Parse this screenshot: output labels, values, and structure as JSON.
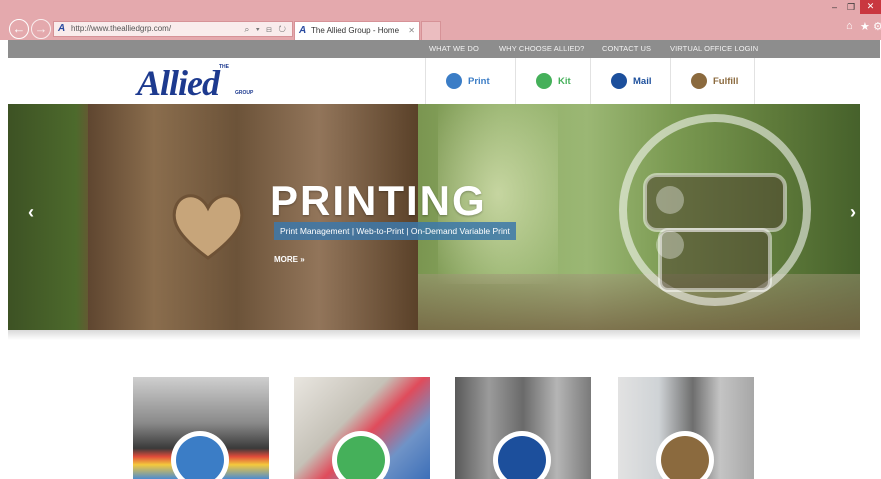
{
  "browser": {
    "back_glyph": "←",
    "forward_glyph": "→",
    "url": "http://www.thealliedgrp.com/",
    "address_tools": "⌕ ▾ ⊟ ↻",
    "tab_title": "The Allied Group - Home",
    "tab_close": "✕",
    "minimize": "–",
    "restore": "❐",
    "close": "✕",
    "home_glyph": "⌂",
    "star_glyph": "★",
    "gear_glyph": "⚙"
  },
  "site_nav": {
    "items": [
      "WHAT WE DO",
      "WHY CHOOSE ALLIED?",
      "CONTACT US",
      "VIRTUAL OFFICE LOGIN"
    ]
  },
  "logo": {
    "word": "Allied",
    "the": "THE",
    "group": "GROUP"
  },
  "services": [
    {
      "label": "Print",
      "color": "#3b7dc6"
    },
    {
      "label": "Kit",
      "color": "#45b05a"
    },
    {
      "label": "Mail",
      "color": "#1c4f9c"
    },
    {
      "label": "Fulfill",
      "color": "#8b6a3e"
    }
  ],
  "hero": {
    "title": "PRINTING",
    "subtitle": "Print Management | Web-to-Print | On-Demand Variable Print",
    "more": "MORE »",
    "prev": "‹",
    "next": "›"
  },
  "tiles": [
    {
      "icon": "print-icon",
      "color": "#3b7dc6"
    },
    {
      "icon": "kit-icon",
      "color": "#45b05a"
    },
    {
      "icon": "mail-icon",
      "color": "#1c4f9c"
    },
    {
      "icon": "fulfill-icon",
      "color": "#8b6a3e"
    }
  ]
}
